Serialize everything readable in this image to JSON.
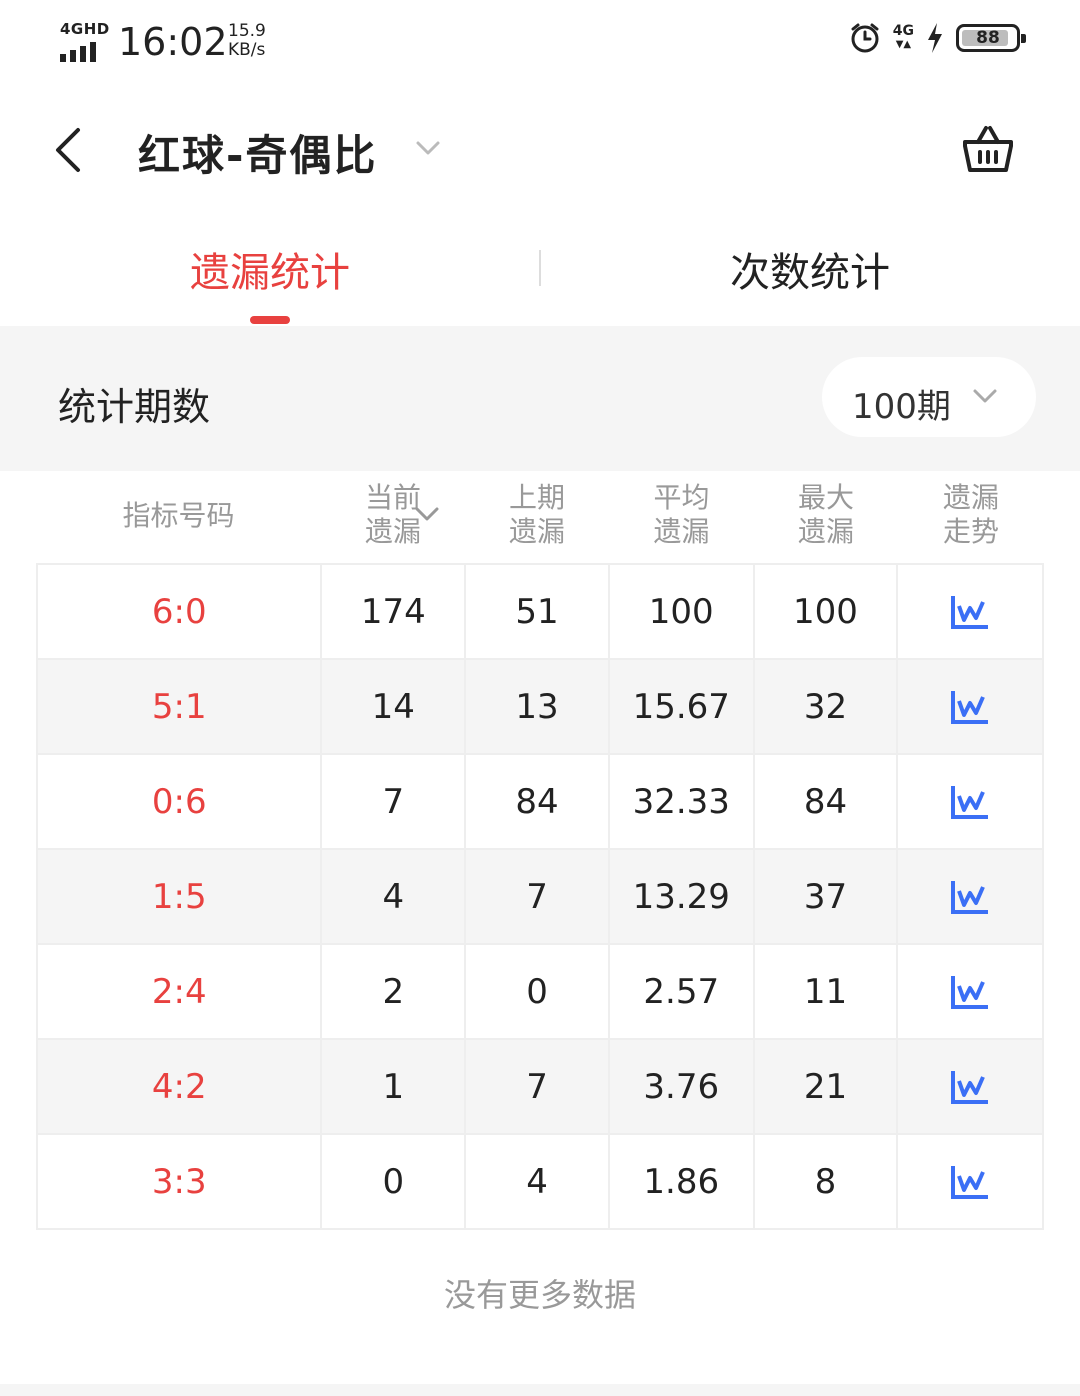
{
  "status_bar": {
    "network": "4GHD",
    "time": "16:02",
    "speed_value": "15.9",
    "speed_unit": "KB/s",
    "signal_right": "4G",
    "battery": "88",
    "battery_level": 0.88
  },
  "nav": {
    "title": "红球-奇偶比"
  },
  "tabs": {
    "active_label": "遗漏统计",
    "inactive_label": "次数统计"
  },
  "period": {
    "label": "统计期数",
    "selected": "100期"
  },
  "table": {
    "headers": [
      {
        "line1": "指标号码",
        "line2": ""
      },
      {
        "line1": "当前",
        "line2": "遗漏"
      },
      {
        "line1": "上期",
        "line2": "遗漏"
      },
      {
        "line1": "平均",
        "line2": "遗漏"
      },
      {
        "line1": "最大",
        "line2": "遗漏"
      },
      {
        "line1": "遗漏",
        "line2": "走势"
      }
    ],
    "rows": [
      {
        "ratio": "6:0",
        "current": "174",
        "last": "51",
        "avg": "100",
        "max": "100"
      },
      {
        "ratio": "5:1",
        "current": "14",
        "last": "13",
        "avg": "15.67",
        "max": "32"
      },
      {
        "ratio": "0:6",
        "current": "7",
        "last": "84",
        "avg": "32.33",
        "max": "84"
      },
      {
        "ratio": "1:5",
        "current": "4",
        "last": "7",
        "avg": "13.29",
        "max": "37"
      },
      {
        "ratio": "2:4",
        "current": "2",
        "last": "0",
        "avg": "2.57",
        "max": "11"
      },
      {
        "ratio": "4:2",
        "current": "1",
        "last": "7",
        "avg": "3.76",
        "max": "21"
      },
      {
        "ratio": "3:3",
        "current": "0",
        "last": "4",
        "avg": "1.86",
        "max": "8"
      }
    ]
  },
  "footer": {
    "no_more": "没有更多数据"
  },
  "colors": {
    "accent": "#e8413f",
    "trend_icon": "#3b6ff5",
    "band": "#f5f5f5"
  },
  "icons": [
    "back-arrow-icon",
    "chevron-down-icon",
    "basket-icon",
    "trend-chart-icon",
    "alarm-icon",
    "bolt-icon",
    "battery-icon"
  ]
}
